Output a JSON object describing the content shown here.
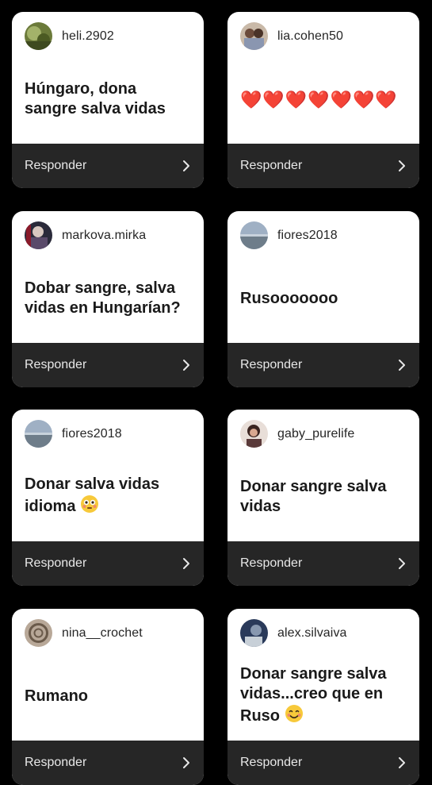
{
  "cards": [
    {
      "username": "heli.2902",
      "message": "Húngaro, dona sangre salva vidas",
      "reply_label": "Responder"
    },
    {
      "username": "lia.cohen50",
      "message": "❤️❤️❤️❤️❤️❤️❤️",
      "reply_label": "Responder"
    },
    {
      "username": "markova.mirka",
      "message": "Dobar sangre, salva vidas en Hungarían?",
      "reply_label": "Responder"
    },
    {
      "username": "fiores2018",
      "message": "Rusooooooo",
      "reply_label": "Responder"
    },
    {
      "username": "fiores2018",
      "message": "Donar salva vidas idioma",
      "emoji": "flushed-face",
      "reply_label": "Responder"
    },
    {
      "username": "gaby_purelife",
      "message": "Donar sangre salva vidas",
      "reply_label": "Responder"
    },
    {
      "username": "nina__crochet",
      "message": "Rumano",
      "reply_label": "Responder"
    },
    {
      "username": "alex.silvaiva",
      "message": "Donar sangre salva vidas...creo que en Ruso",
      "emoji": "smiling-face",
      "reply_label": "Responder"
    }
  ],
  "colors": {
    "background": "#000000",
    "card": "#ffffff",
    "reply_bar": "#262626",
    "heart": "#e0152b"
  }
}
